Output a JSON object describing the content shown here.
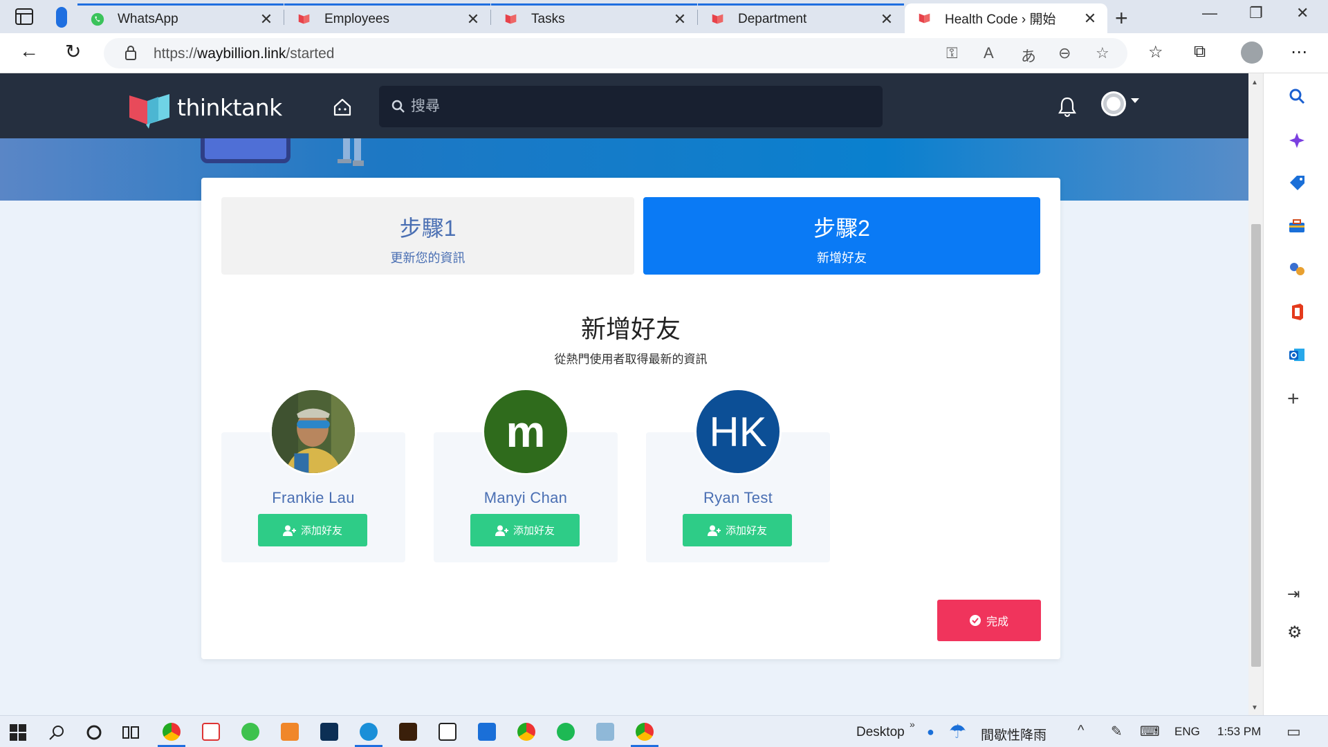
{
  "browser": {
    "tabs": [
      {
        "title": "WhatsApp",
        "favicon": "whatsapp-icon"
      },
      {
        "title": "Employees",
        "favicon": "thinktank-icon"
      },
      {
        "title": "Tasks",
        "favicon": "thinktank-icon"
      },
      {
        "title": "Department",
        "favicon": "thinktank-icon"
      },
      {
        "title": "Health Code › 開始",
        "favicon": "thinktank-icon",
        "active": true
      }
    ],
    "url_prefix": "https://",
    "url_domain": "waybillion.link",
    "url_path": "/started"
  },
  "app": {
    "brand": "thinktank",
    "search_placeholder": "搜尋"
  },
  "steps": [
    {
      "title": "步驟1",
      "subtitle": "更新您的資訊",
      "active": false
    },
    {
      "title": "步驟2",
      "subtitle": "新增好友",
      "active": true
    }
  ],
  "section": {
    "title": "新增好友",
    "subtitle": "從熱門使用者取得最新的資訊"
  },
  "friends": [
    {
      "name": "Frankie Lau",
      "avatar": "photo",
      "button": "添加好友"
    },
    {
      "name": "Manyi Chan",
      "avatar_text": "m",
      "avatar_color": "#2f6b1c",
      "button": "添加好友"
    },
    {
      "name": "Ryan Test",
      "avatar_text": "HK",
      "avatar_color": "#0c4f96",
      "button": "添加好友"
    }
  ],
  "done_label": "完成",
  "colors": {
    "header": "#252f3f",
    "step_active": "#0a7af5",
    "add_button": "#2ecc87",
    "done_button": "#f0345c"
  },
  "taskbar": {
    "desktop_label": "Desktop",
    "weather": "間歇性降雨",
    "lang": "ENG",
    "time": "1:53 PM"
  }
}
